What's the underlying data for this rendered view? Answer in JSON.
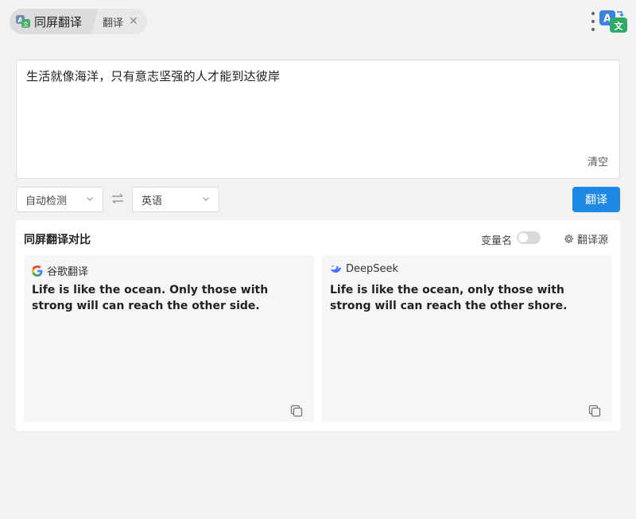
{
  "header": {
    "tab_main_label": "同屏翻译",
    "tab_sub_label": "翻译",
    "close_glyph": "✕"
  },
  "input": {
    "text": "生活就像海洋，只有意志坚强的人才能到达彼岸",
    "clear_label": "清空"
  },
  "languages": {
    "source": "自动检测",
    "target": "英语"
  },
  "translate_button": "翻译",
  "compare": {
    "title": "同屏翻译对比",
    "variable_label": "变量名",
    "variable_toggle_on": false,
    "source_label": "翻译源"
  },
  "results": [
    {
      "engine": "谷歌翻译",
      "icon": "google-icon",
      "text": "Life is like the ocean. Only those with strong will can reach the other side."
    },
    {
      "engine": "DeepSeek",
      "icon": "deepseek-icon",
      "text": "Life is like the ocean, only those with strong will can reach the other shore."
    }
  ],
  "colors": {
    "accent": "#1e88e5",
    "background": "#f2f2f3",
    "card": "#f5f6f8"
  }
}
